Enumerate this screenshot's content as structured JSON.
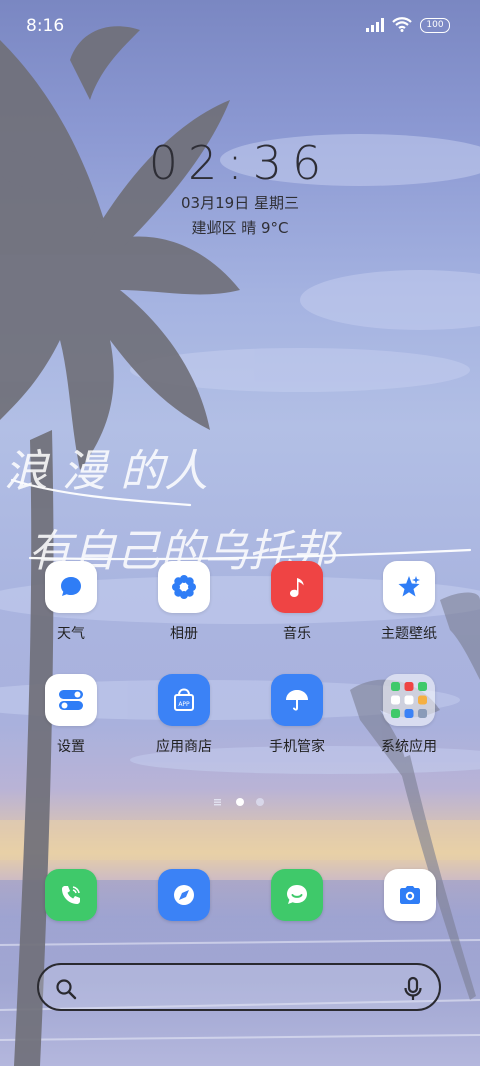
{
  "status_bar": {
    "time": "8:16",
    "battery": "100"
  },
  "widget": {
    "clock": "02:36",
    "date": "03月19日 星期三",
    "weather": "建邺区 晴 9°C"
  },
  "wallpaper": {
    "line1": "浪 漫 的人",
    "line2": "有自己的乌托邦"
  },
  "apps": [
    {
      "label": "天气",
      "icon": "chat-bubble-icon",
      "bg": "#ffffff",
      "fg": "#2f7df6"
    },
    {
      "label": "相册",
      "icon": "gear-flower-icon",
      "bg": "#ffffff",
      "fg": "#2f7df6"
    },
    {
      "label": "音乐",
      "icon": "music-note-icon",
      "bg": "#ef4444",
      "fg": "#ffffff"
    },
    {
      "label": "主题壁纸",
      "icon": "star-sparkle-icon",
      "bg": "#ffffff",
      "fg": "#2f7df6"
    },
    {
      "label": "设置",
      "icon": "toggle-switches-icon",
      "bg": "#ffffff",
      "fg": "#2f7df6"
    },
    {
      "label": "应用商店",
      "icon": "shopping-bag-icon",
      "bg": "#3b82f6",
      "fg": "#ffffff",
      "badge": "APP"
    },
    {
      "label": "手机管家",
      "icon": "umbrella-icon",
      "bg": "#3b82f6",
      "fg": "#ffffff"
    },
    {
      "label": "系统应用",
      "icon": "folder-icon",
      "bg": "rgba(255,255,255,0.55)"
    }
  ],
  "dock": [
    {
      "name": "phone",
      "icon": "phone-icon",
      "bg": "#3fc96a"
    },
    {
      "name": "browser",
      "icon": "compass-icon",
      "bg": "#3b82f6"
    },
    {
      "name": "messages",
      "icon": "message-icon",
      "bg": "#3fc96a"
    },
    {
      "name": "camera",
      "icon": "camera-icon",
      "bg": "#ffffff"
    }
  ],
  "search": {
    "placeholder": ""
  },
  "pages": {
    "current": 2,
    "total": 3
  }
}
